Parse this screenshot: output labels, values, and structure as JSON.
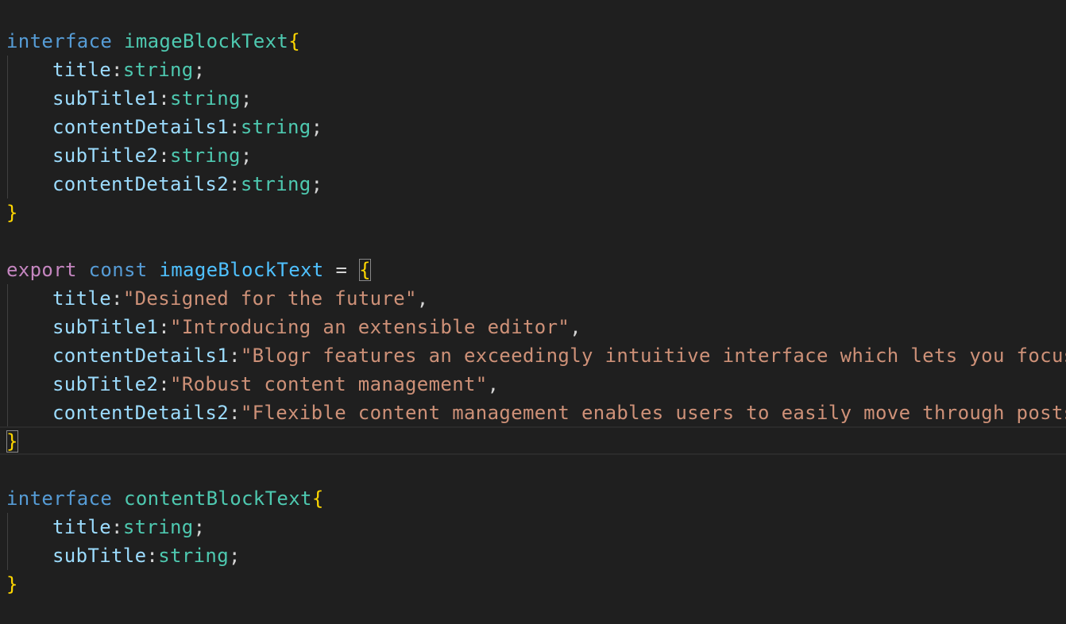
{
  "editor": {
    "block1": {
      "keyword": "interface",
      "name": "imageBlockText",
      "open": "{",
      "close": "}",
      "fields": [
        {
          "prop": "title",
          "type": "string"
        },
        {
          "prop": "subTitle1",
          "type": "string"
        },
        {
          "prop": "contentDetails1",
          "type": "string"
        },
        {
          "prop": "subTitle2",
          "type": "string"
        },
        {
          "prop": "contentDetails2",
          "type": "string"
        }
      ]
    },
    "block2": {
      "keyword_export": "export",
      "keyword_const": "const",
      "name": "imageBlockText",
      "assign": "=",
      "open": "{",
      "close": "}",
      "entries": [
        {
          "prop": "title",
          "value": "\"Designed for the future\"",
          "trail": ","
        },
        {
          "prop": "subTitle1",
          "value": "\"Introducing an extensible editor\"",
          "trail": ","
        },
        {
          "prop": "contentDetails1",
          "value": "\"Blogr features an exceedingly intuitive interface which lets you focus o",
          "trail": ""
        },
        {
          "prop": "subTitle2",
          "value": "\"Robust content management\"",
          "trail": ","
        },
        {
          "prop": "contentDetails2",
          "value": "\"Flexible content management enables users to easily move through posts.",
          "trail": ""
        }
      ]
    },
    "block3": {
      "keyword": "interface",
      "name": "contentBlockText",
      "open": "{",
      "close": "}",
      "fields": [
        {
          "prop": "title",
          "type": "string"
        },
        {
          "prop": "subTitle",
          "type": "string"
        }
      ]
    },
    "colon": ":",
    "semicolon": ";"
  }
}
